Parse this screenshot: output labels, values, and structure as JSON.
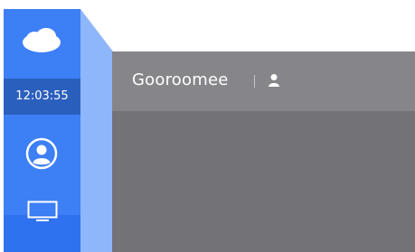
{
  "sidebar": {
    "logo_icon": "cloud-icon",
    "clock": "12:03:55",
    "user_icon": "user-circle-icon",
    "screen_icon": "monitor-icon",
    "color": "#3d7ff5",
    "clock_bg": "#2b5fbe"
  },
  "header": {
    "brand": "Gooroomee",
    "user_icon": "person-icon",
    "color": "#86868a"
  },
  "content": {
    "color": "#737377"
  }
}
